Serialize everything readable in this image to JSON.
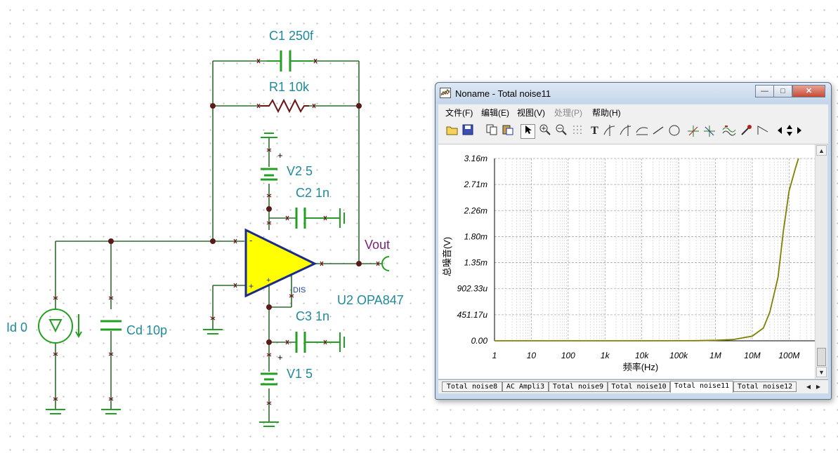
{
  "schematic": {
    "labels": {
      "c1": "C1 250f",
      "r1": "R1 10k",
      "v2": "V2 5",
      "c2": "C2 1n",
      "vout": "Vout",
      "dis": "DIS",
      "u2": "U2 OPA847",
      "c3": "C3 1n",
      "id": "Id 0",
      "cd": "Cd 10p",
      "v1": "V1 5",
      "minus": "-",
      "plus": "+"
    },
    "colors": {
      "wire": "#2e6b2e",
      "component": "#23a023",
      "opamp_fill": "#ffff00",
      "opamp_stroke": "#1a2b8c",
      "node": "#5a1a1a",
      "label": "#1f8a9a"
    }
  },
  "window": {
    "title": "Noname - Total noise11",
    "controls": {
      "minimize": "—",
      "maximize": "□",
      "close": "✕"
    },
    "menu": [
      {
        "label": "文件(F)",
        "enabled": true
      },
      {
        "label": "编辑(E)",
        "enabled": true
      },
      {
        "label": "视图(V)",
        "enabled": true
      },
      {
        "label": "处理(P)",
        "enabled": false
      },
      {
        "label": "帮助(H)",
        "enabled": true
      }
    ],
    "toolbar_icons": [
      "open-icon",
      "save-icon",
      "copy-icon",
      "paste-icon",
      "pointer-icon",
      "zoom-in-icon",
      "zoom-out-icon",
      "grid-icon",
      "text-icon",
      "cursor-a-icon",
      "cursor-b-icon",
      "curve-icon",
      "line-icon",
      "circle-icon",
      "marker-a-icon",
      "marker-b-icon",
      "wave-icon",
      "probe-icon",
      "tangent-icon",
      "nav-left-icon",
      "nav-updown-icon",
      "nav-right-icon"
    ],
    "tabs": [
      {
        "label": "Total noise8",
        "active": false
      },
      {
        "label": "AC Ampli3",
        "active": false
      },
      {
        "label": "Total noise9",
        "active": false
      },
      {
        "label": "Total noise10",
        "active": false
      },
      {
        "label": "Total noise11",
        "active": true
      },
      {
        "label": "Total noise12",
        "active": false
      }
    ]
  },
  "chart_data": {
    "type": "line",
    "xlabel": "频率(Hz)",
    "ylabel": "总噪音(V)",
    "xscale": "log",
    "xlim": [
      1,
      500000000
    ],
    "ylim": [
      0,
      0.00316
    ],
    "x_ticks": [
      "1",
      "10",
      "100",
      "1k",
      "10k",
      "100k",
      "1M",
      "10M",
      "100M"
    ],
    "y_ticks": [
      "0.00",
      "451.17u",
      "902.33u",
      "1.35m",
      "1.80m",
      "2.26m",
      "2.71m",
      "3.16m"
    ],
    "grid": true,
    "series": [
      {
        "color": "#808000",
        "x": [
          1,
          10,
          100,
          1000,
          10000,
          100000,
          300000,
          1000000,
          3000000,
          10000000,
          20000000,
          30000000,
          50000000,
          70000000,
          100000000,
          150000000,
          180000000
        ],
        "y": [
          0,
          0,
          0,
          0,
          0,
          1e-06,
          3e-06,
          8e-06,
          2.2e-05,
          8e-05,
          0.00022,
          0.0005,
          0.0011,
          0.0019,
          0.0026,
          0.003,
          0.00316
        ]
      }
    ]
  }
}
